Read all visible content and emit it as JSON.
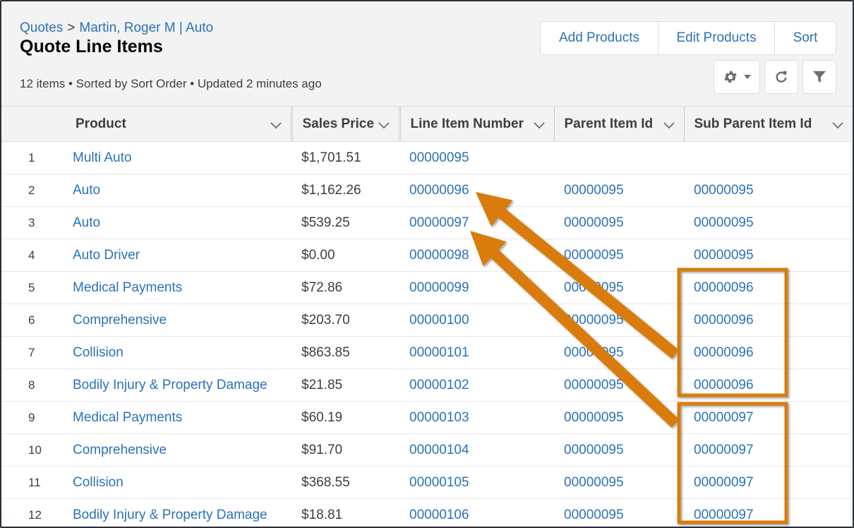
{
  "header": {
    "breadcrumb": {
      "parent": "Quotes",
      "separator": ">",
      "record": "Martin, Roger M | Auto"
    },
    "title": "Quote Line Items",
    "meta": "12 items • Sorted by Sort Order • Updated 2 minutes ago",
    "buttons": {
      "add_products": "Add Products",
      "edit_products": "Edit Products",
      "sort": "Sort"
    },
    "icon_buttons": [
      "gear-dropdown-icon",
      "refresh-icon",
      "filter-icon"
    ]
  },
  "table": {
    "columns": [
      {
        "label": ""
      },
      {
        "label": "Product"
      },
      {
        "label": "Sales Price"
      },
      {
        "label": "Line Item Number"
      },
      {
        "label": "Parent Item Id"
      },
      {
        "label": "Sub Parent Item Id"
      }
    ],
    "rows": [
      {
        "n": "1",
        "product": "Multi Auto",
        "price": "$1,701.51",
        "line": "00000095",
        "parent": "",
        "sub": ""
      },
      {
        "n": "2",
        "product": "Auto",
        "price": "$1,162.26",
        "line": "00000096",
        "parent": "00000095",
        "sub": "00000095"
      },
      {
        "n": "3",
        "product": "Auto",
        "price": "$539.25",
        "line": "00000097",
        "parent": "00000095",
        "sub": "00000095"
      },
      {
        "n": "4",
        "product": "Auto Driver",
        "price": "$0.00",
        "line": "00000098",
        "parent": "00000095",
        "sub": "00000095"
      },
      {
        "n": "5",
        "product": "Medical Payments",
        "price": "$72.86",
        "line": "00000099",
        "parent": "00000095",
        "sub": "00000096"
      },
      {
        "n": "6",
        "product": "Comprehensive",
        "price": "$203.70",
        "line": "00000100",
        "parent": "00000095",
        "sub": "00000096"
      },
      {
        "n": "7",
        "product": "Collision",
        "price": "$863.85",
        "line": "00000101",
        "parent": "00000095",
        "sub": "00000096"
      },
      {
        "n": "8",
        "product": "Bodily Injury & Property Damage",
        "price": "$21.85",
        "line": "00000102",
        "parent": "00000095",
        "sub": "00000096"
      },
      {
        "n": "9",
        "product": "Medical Payments",
        "price": "$60.19",
        "line": "00000103",
        "parent": "00000095",
        "sub": "00000097"
      },
      {
        "n": "10",
        "product": "Comprehensive",
        "price": "$91.70",
        "line": "00000104",
        "parent": "00000095",
        "sub": "00000097"
      },
      {
        "n": "11",
        "product": "Collision",
        "price": "$368.55",
        "line": "00000105",
        "parent": "00000095",
        "sub": "00000097"
      },
      {
        "n": "12",
        "product": "Bodily Injury & Property Damage",
        "price": "$18.81",
        "line": "00000106",
        "parent": "00000095",
        "sub": "00000097"
      }
    ]
  },
  "annotations": {
    "color": "#d97b0b",
    "highlight_groups": [
      {
        "sub_parent": "00000096",
        "rows": [
          "5",
          "6",
          "7",
          "8"
        ],
        "points_to_line_item": "00000096"
      },
      {
        "sub_parent": "00000097",
        "rows": [
          "9",
          "10",
          "11",
          "12"
        ],
        "points_to_line_item": "00000097"
      }
    ]
  }
}
